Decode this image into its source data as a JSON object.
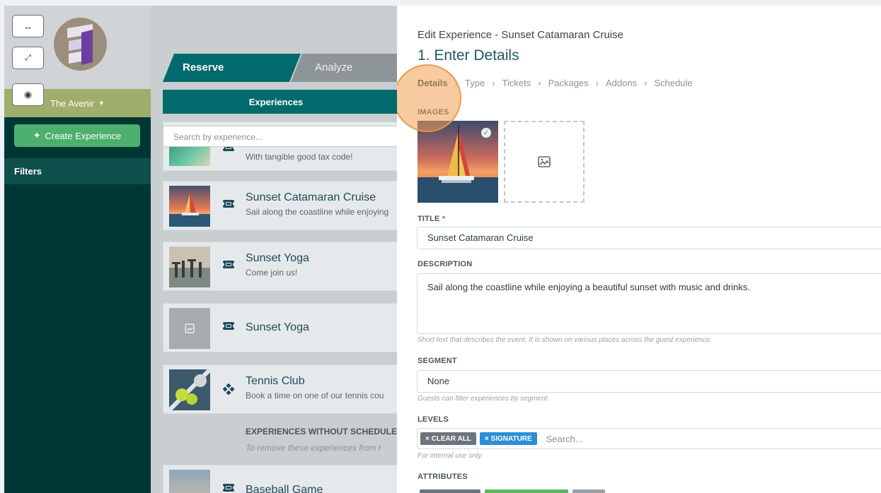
{
  "sidebar": {
    "property_name": "The Avenir",
    "create_label": "Create Experience",
    "filters_label": "Filters",
    "icons": [
      "expand-horizontal-icon",
      "fullscreen-icon",
      "eye-icon"
    ]
  },
  "tabs": {
    "reserve": "Reserve",
    "analyze": "Analyze",
    "experiences": "Experiences"
  },
  "search": {
    "placeholder": "Search by experience..."
  },
  "experiences": [
    {
      "title": "",
      "subtitle": "With tangible good tax code!",
      "icon": "ticket-icon"
    },
    {
      "title": "Sunset Catamaran Cruise",
      "subtitle": "Sail along the coastline while enjoying",
      "icon": "ticket-icon"
    },
    {
      "title": "Sunset Yoga",
      "subtitle": "Come join us!",
      "icon": "ticket-icon"
    },
    {
      "title": "Sunset Yoga",
      "subtitle": "",
      "icon": "ticket-icon"
    },
    {
      "title": "Tennis Club",
      "subtitle": "Book a time on one of our tennis cou",
      "icon": "diamond-grid-icon"
    },
    {
      "title": "Baseball Game",
      "subtitle": "",
      "icon": "ticket-icon"
    }
  ],
  "no_schedule": {
    "heading": "EXPERIENCES WITHOUT SCHEDULES",
    "subtitle": "To remove these experiences from t"
  },
  "editor": {
    "heading": "Edit Experience - Sunset Catamaran Cruise",
    "step_title": "1. Enter Details",
    "steps": [
      "Details",
      "Type",
      "Tickets",
      "Packages",
      "Addons",
      "Schedule"
    ],
    "images_label": "IMAGES",
    "title_label": "TITLE",
    "title_required": "*",
    "title_value": "Sunset Catamaran Cruise",
    "description_label": "DESCRIPTION",
    "description_value": "Sail along the coastline while enjoying a beautiful sunset with music and drinks.",
    "description_hint": "Short text that describes the event. It is shown on various places across the guest experience.",
    "segment_label": "SEGMENT",
    "segment_value": "None",
    "segment_hint": "Guests can filter experiences by segment.",
    "levels_label": "LEVELS",
    "levels_tags": [
      "× CLEAR ALL",
      "× SIGNATURE"
    ],
    "levels_placeholder": "Search...",
    "levels_hint": "For internal use only.",
    "attributes_label": "ATTRIBUTES"
  },
  "colors": {
    "sidebar_bg": "#003633",
    "accent_teal": "#006a6c",
    "create_green": "#4caf6e",
    "property_bar": "#9fae6a",
    "highlight_orange": "#f0a050"
  }
}
